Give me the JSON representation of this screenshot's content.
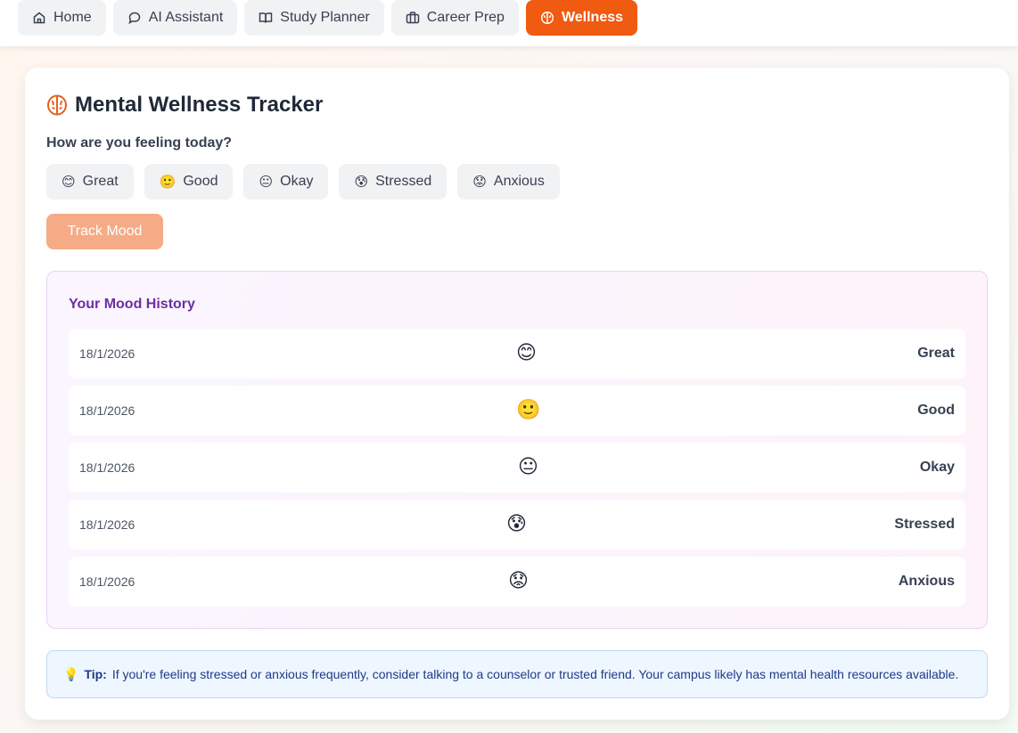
{
  "nav": {
    "tabs": [
      {
        "label": "Home",
        "icon": "home-icon"
      },
      {
        "label": "AI Assistant",
        "icon": "chat-icon"
      },
      {
        "label": "Study Planner",
        "icon": "book-icon"
      },
      {
        "label": "Career Prep",
        "icon": "briefcase-icon"
      },
      {
        "label": "Wellness",
        "icon": "brain-icon",
        "active": true
      }
    ],
    "accent": "#f05a11"
  },
  "main": {
    "title": "Mental Wellness Tracker",
    "question": "How are you feeling today?",
    "moods": [
      {
        "emoji": "😊",
        "label": "Great"
      },
      {
        "emoji": "🙂",
        "label": "Good"
      },
      {
        "emoji": "😐",
        "label": "Okay"
      },
      {
        "emoji": "😰",
        "label": "Stressed"
      },
      {
        "emoji": "😟",
        "label": "Anxious"
      }
    ],
    "track_label": "Track Mood"
  },
  "history": {
    "title": "Your Mood History",
    "entries": [
      {
        "date": "18/1/2026",
        "emoji": "😊",
        "label": "Great"
      },
      {
        "date": "18/1/2026",
        "emoji": "🙂",
        "label": "Good"
      },
      {
        "date": "18/1/2026",
        "emoji": "😐",
        "label": "Okay"
      },
      {
        "date": "18/1/2026",
        "emoji": "😰",
        "label": "Stressed"
      },
      {
        "date": "18/1/2026",
        "emoji": "😟",
        "label": "Anxious"
      }
    ]
  },
  "tip": {
    "icon": "💡",
    "label": "Tip:",
    "text": "If you're feeling stressed or anxious frequently, consider talking to a counselor or trusted friend. Your campus likely has mental health resources available."
  }
}
